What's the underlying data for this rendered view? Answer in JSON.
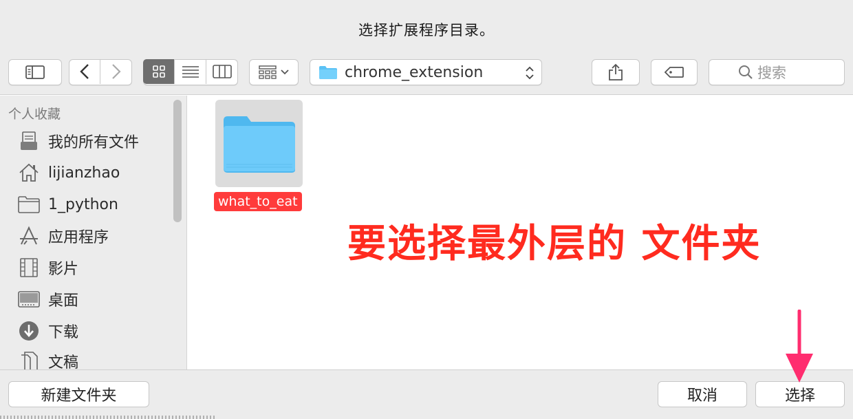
{
  "window": {
    "title": "选择扩展程序目录。"
  },
  "toolbar": {
    "path_label": "chrome_extension",
    "search_placeholder": "搜索"
  },
  "sidebar": {
    "section_title": "个人收藏",
    "items": [
      {
        "label": "我的所有文件",
        "icon": "all-files-icon"
      },
      {
        "label": "lijianzhao",
        "icon": "home-icon"
      },
      {
        "label": "1_python",
        "icon": "folder-icon"
      },
      {
        "label": "应用程序",
        "icon": "applications-icon"
      },
      {
        "label": "影片",
        "icon": "movies-icon"
      },
      {
        "label": "桌面",
        "icon": "desktop-icon"
      },
      {
        "label": "下载",
        "icon": "downloads-icon"
      },
      {
        "label": "文稿",
        "icon": "documents-icon"
      }
    ]
  },
  "main": {
    "items": [
      {
        "name": "what_to_eat",
        "type": "folder",
        "selected": true
      }
    ],
    "annotation": "要选择最外层的 文件夹"
  },
  "bottom": {
    "new_folder": "新建文件夹",
    "cancel": "取消",
    "choose": "选择"
  },
  "colors": {
    "accent_red": "#ff3b3b",
    "annotation_red": "#ff2b1f",
    "arrow_pink": "#ff2d6f",
    "folder_blue": "#5bc2f5"
  }
}
